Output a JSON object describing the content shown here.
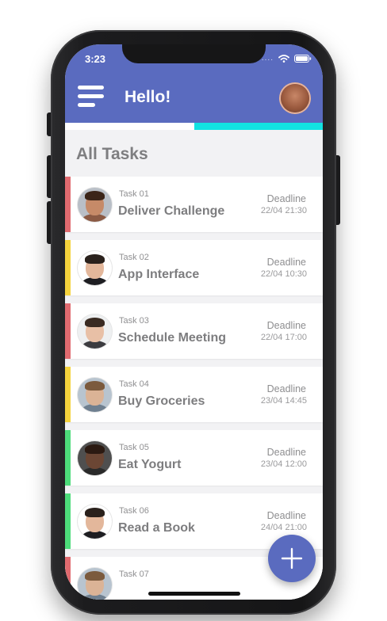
{
  "status_bar": {
    "time": "3:23",
    "signal": "....",
    "icons": [
      "wifi-icon",
      "battery-icon"
    ]
  },
  "header": {
    "greeting": "Hello!",
    "menu_icon": "hamburger-icon",
    "avatar": "user-avatar",
    "background": "#5a6bbf"
  },
  "progress": {
    "fraction": 0.5,
    "color": "#12e2e2"
  },
  "section": {
    "title": "All Tasks"
  },
  "tasks": [
    {
      "number": "Task 01",
      "name": "Deliver Challenge",
      "deadline_label": "Deadline",
      "deadline": "22/04 21:30",
      "priority_color": "#e06a6f"
    },
    {
      "number": "Task 02",
      "name": "App Interface",
      "deadline_label": "Deadline",
      "deadline": "22/04 10:30",
      "priority_color": "#f5d23c"
    },
    {
      "number": "Task 03",
      "name": "Schedule Meeting",
      "deadline_label": "Deadline",
      "deadline": "22/04 17:00",
      "priority_color": "#e06a6f"
    },
    {
      "number": "Task 04",
      "name": "Buy Groceries",
      "deadline_label": "Deadline",
      "deadline": "23/04 14:45",
      "priority_color": "#f5d23c"
    },
    {
      "number": "Task 05",
      "name": "Eat Yogurt",
      "deadline_label": "Deadline",
      "deadline": "23/04 12:00",
      "priority_color": "#4ddc7a"
    },
    {
      "number": "Task 06",
      "name": "Read a Book",
      "deadline_label": "Deadline",
      "deadline": "24/04 21:00",
      "priority_color": "#4ddc7a"
    },
    {
      "number": "Task 07",
      "name": "",
      "deadline_label": "",
      "deadline": "",
      "priority_color": "#e06a6f"
    }
  ],
  "fab": {
    "icon": "plus-icon",
    "color": "#5a6bbf"
  }
}
